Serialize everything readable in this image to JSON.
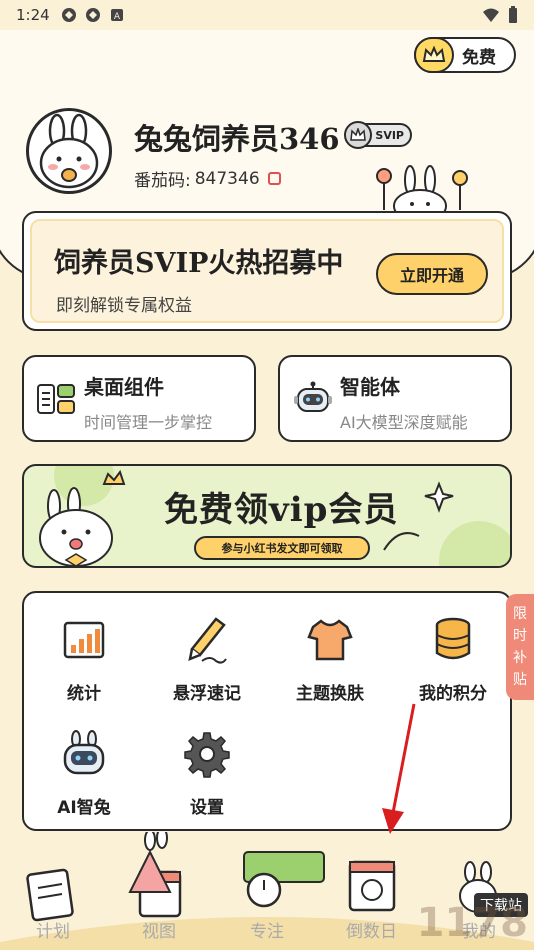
{
  "status_bar": {
    "time": "1:24"
  },
  "header": {
    "free_label": "免费",
    "username": "兔兔饲养员346",
    "badge": "SVIP",
    "id_label": "番茄码:",
    "id_value": "847346"
  },
  "vip_card": {
    "title": "饲养员SVIP火热招募中",
    "subtitle": "即刻解锁专属权益",
    "button": "立即开通"
  },
  "features": [
    {
      "title": "桌面组件",
      "subtitle": "时间管理一步掌控",
      "icon": "widget-icon"
    },
    {
      "title": "智能体",
      "subtitle": "AI大模型深度赋能",
      "icon": "robot-icon"
    }
  ],
  "banner": {
    "title": "免费领vip会员",
    "pill": "参与小红书发文即可领取"
  },
  "tools": [
    {
      "label": "统计",
      "icon": "chart-icon"
    },
    {
      "label": "悬浮速记",
      "icon": "pen-icon"
    },
    {
      "label": "主题换肤",
      "icon": "shirt-icon"
    },
    {
      "label": "我的积分",
      "icon": "coins-icon"
    },
    {
      "label": "AI智兔",
      "icon": "robot-icon"
    },
    {
      "label": "设置",
      "icon": "gear-icon"
    }
  ],
  "side_tab": [
    "限",
    "时",
    "补",
    "贴"
  ],
  "nav": [
    "计划",
    "视图",
    "专注",
    "倒数日",
    "我的"
  ],
  "watermark": {
    "text": "1178",
    "badge": "下载站"
  },
  "colors": {
    "background": "#fbf1d7",
    "accent": "#ffd16a",
    "side_tab": "#f08a78",
    "arrow": "#d81e1e"
  }
}
